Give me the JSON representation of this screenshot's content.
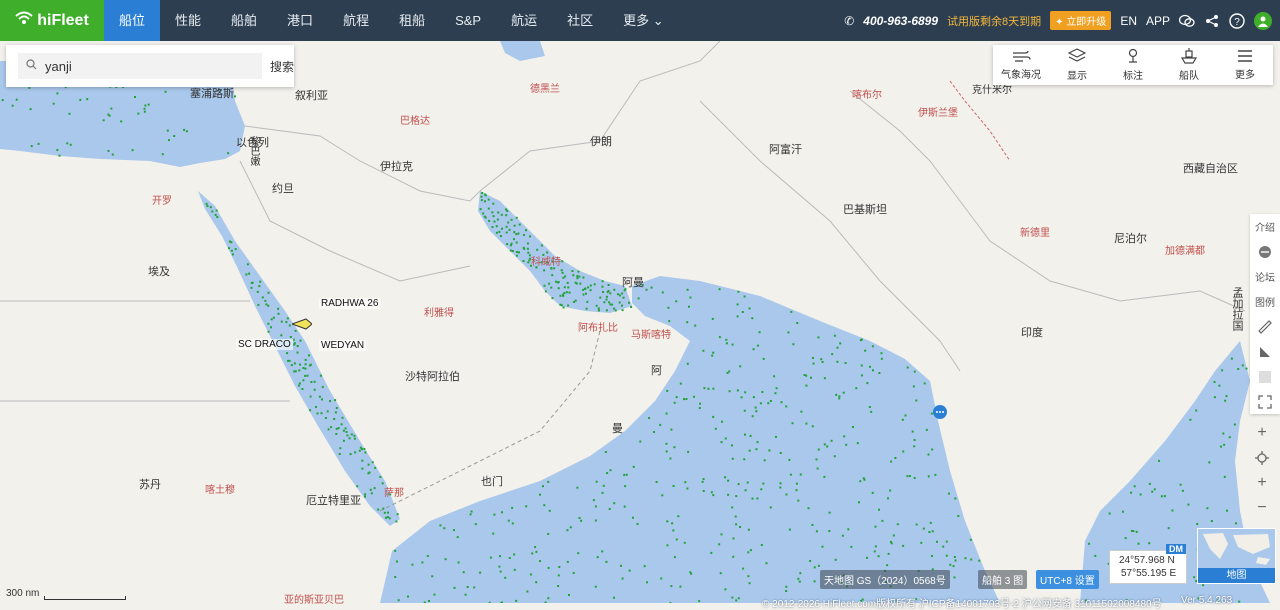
{
  "topbar": {
    "logo": "hiFleet",
    "nav": [
      "船位",
      "性能",
      "船舶",
      "港口",
      "航程",
      "租船",
      "S&P",
      "航运",
      "社区",
      "更多"
    ],
    "phone": "400-963-6899",
    "trial": "试用版剩余8天到期",
    "upgrade": "立即升级",
    "lang": "EN",
    "app": "APP"
  },
  "search": {
    "value": "yanji",
    "button": "搜索"
  },
  "tools": [
    "气象海况",
    "显示",
    "标注",
    "船队",
    "更多"
  ],
  "sidebar": [
    "介绍",
    "论坛",
    "图例"
  ],
  "places": {
    "cyprus": "塞浦路斯",
    "syria": "叙利亚",
    "lebanon": "黎巴嫩",
    "israel": "以色列",
    "jordan": "约旦",
    "iraq": "伊拉克",
    "iran": "伊朗",
    "afghanistan": "阿富汗",
    "pakistan": "巴基斯坦",
    "egypt": "埃及",
    "saudi": "沙特阿拉伯",
    "oman1": "阿",
    "oman2": "曼",
    "yemen": "也门",
    "sudan": "苏丹",
    "eritrea": "厄立特里亚",
    "india": "印度",
    "nepal": "尼泊尔",
    "tibet": "西藏自治区",
    "kashmir": "克什米尔",
    "bangladesh": "孟加拉国",
    "uae": "阿曼"
  },
  "cities": {
    "tehran": "德黑兰",
    "baghdad": "巴格达",
    "kabul": "喀布尔",
    "islamabad": "伊斯兰堡",
    "cairo": "开罗",
    "riyadh": "利雅得",
    "abudhabi": "阿布扎比",
    "muscat": "马斯喀特",
    "newdelhi": "新德里",
    "kathmandu": "加德满都",
    "khartoum": "喀土穆",
    "sanaa": "萨那",
    "addisababa": "亚的斯亚贝巴",
    "kuwait": "科威特"
  },
  "ships": {
    "radhwa": "RADHWA 26",
    "scdraco": "SC DRACO",
    "wedyan": "WEDYAN"
  },
  "bottom": {
    "scale": "300 nm",
    "mapsource": "天地图 GS（2024）0568号",
    "layer": "船舶 3 图",
    "tz": "UTC+8 设置",
    "lat": "24°57.968 N",
    "lon": "57°55.195 E",
    "dm": "DM",
    "minimap_label": "地图",
    "copyright": "© 2012-2026 HiFleet.com版权所有 沪ICP备14001703号-2 沪公网安备 31011502008480号",
    "version": "Ver 5.4.263"
  },
  "colors": {
    "sea": "#a9c8ec",
    "land": "#f3f1ec",
    "ship": "#22a33a",
    "topbar": "#2c3e50",
    "active": "#2a7fd4",
    "brand": "#3fae2a"
  }
}
